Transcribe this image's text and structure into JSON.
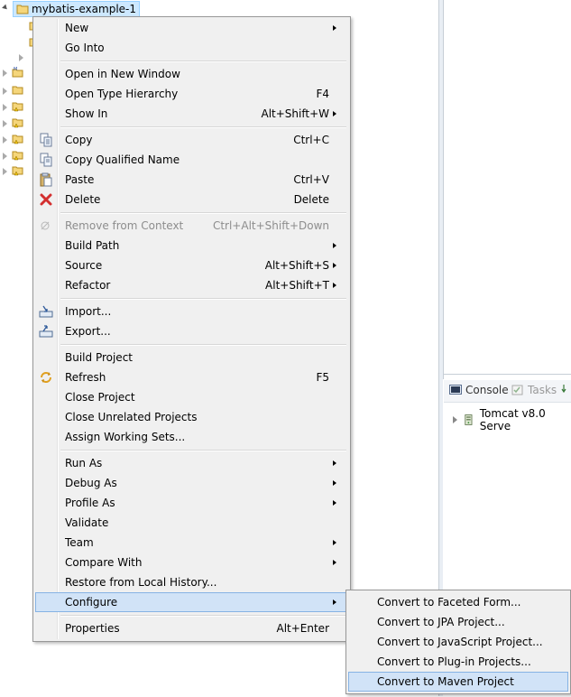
{
  "explorer": {
    "root_project": "mybatis-example-1"
  },
  "console_view": {
    "tabs": [
      {
        "label": "Console"
      },
      {
        "label": "Tasks"
      }
    ],
    "server_label": "Tomcat v8.0 Serve"
  },
  "context_menu": {
    "items": [
      {
        "label": "New",
        "accel": "",
        "submenu": true
      },
      {
        "label": "Go Into",
        "accel": "",
        "submenu": false
      },
      {
        "label": "Open in New Window",
        "accel": "",
        "submenu": false
      },
      {
        "label": "Open Type Hierarchy",
        "accel": "F4",
        "submenu": false
      },
      {
        "label": "Show In",
        "accel": "Alt+Shift+W",
        "submenu": true
      },
      {
        "label": "Copy",
        "accel": "Ctrl+C",
        "submenu": false
      },
      {
        "label": "Copy Qualified Name",
        "accel": "",
        "submenu": false
      },
      {
        "label": "Paste",
        "accel": "Ctrl+V",
        "submenu": false
      },
      {
        "label": "Delete",
        "accel": "Delete",
        "submenu": false
      },
      {
        "label": "Remove from Context",
        "accel": "Ctrl+Alt+Shift+Down",
        "submenu": false,
        "disabled": true
      },
      {
        "label": "Build Path",
        "accel": "",
        "submenu": true
      },
      {
        "label": "Source",
        "accel": "Alt+Shift+S",
        "submenu": true
      },
      {
        "label": "Refactor",
        "accel": "Alt+Shift+T",
        "submenu": true
      },
      {
        "label": "Import...",
        "accel": "",
        "submenu": false
      },
      {
        "label": "Export...",
        "accel": "",
        "submenu": false
      },
      {
        "label": "Build Project",
        "accel": "",
        "submenu": false
      },
      {
        "label": "Refresh",
        "accel": "F5",
        "submenu": false
      },
      {
        "label": "Close Project",
        "accel": "",
        "submenu": false
      },
      {
        "label": "Close Unrelated Projects",
        "accel": "",
        "submenu": false
      },
      {
        "label": "Assign Working Sets...",
        "accel": "",
        "submenu": false
      },
      {
        "label": "Run As",
        "accel": "",
        "submenu": true
      },
      {
        "label": "Debug As",
        "accel": "",
        "submenu": true
      },
      {
        "label": "Profile As",
        "accel": "",
        "submenu": true
      },
      {
        "label": "Validate",
        "accel": "",
        "submenu": false
      },
      {
        "label": "Team",
        "accel": "",
        "submenu": true
      },
      {
        "label": "Compare With",
        "accel": "",
        "submenu": true
      },
      {
        "label": "Restore from Local History...",
        "accel": "",
        "submenu": false
      },
      {
        "label": "Configure",
        "accel": "",
        "submenu": true,
        "selected": true
      },
      {
        "label": "Properties",
        "accel": "Alt+Enter",
        "submenu": false
      }
    ]
  },
  "configure_submenu": {
    "items": [
      {
        "label": "Convert to Faceted Form..."
      },
      {
        "label": "Convert to JPA Project..."
      },
      {
        "label": "Convert to JavaScript Project..."
      },
      {
        "label": "Convert to Plug-in Projects..."
      },
      {
        "label": "Convert to Maven Project",
        "selected": true
      }
    ]
  },
  "colors": {
    "selection_fill": "#d1e3f7",
    "selection_border": "#86b3e4",
    "menu_background": "#f0f0f0"
  }
}
